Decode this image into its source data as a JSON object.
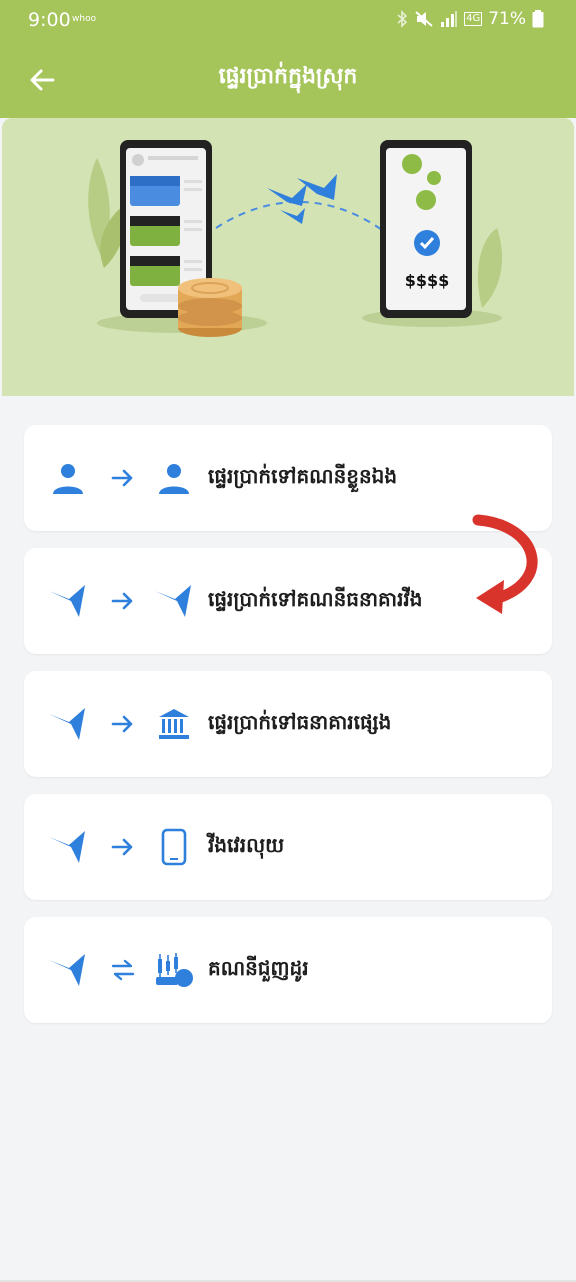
{
  "status_bar": {
    "time": "9:00",
    "carrier": "whoo",
    "battery": "71%",
    "network": "4G"
  },
  "header": {
    "title": "ផ្ទេរប្រាក់ក្នុងស្រុក",
    "back_icon": "arrow-left-icon"
  },
  "hero": {
    "amount_text": "$$$$"
  },
  "menu": {
    "items": [
      {
        "label": "ផ្ទេរប្រាក់ទៅគណនីខ្លួនឯង",
        "left_icon": "person-icon",
        "arrow_icon": "arrow-right-icon",
        "right_icon": "person-icon"
      },
      {
        "label": "ផ្ទេរប្រាក់ទៅគណនីធនាគារវីង",
        "left_icon": "swallow-icon",
        "arrow_icon": "arrow-right-icon",
        "right_icon": "swallow-icon"
      },
      {
        "label": "ផ្ទេរប្រាក់ទៅធនាគារផ្សេង",
        "left_icon": "swallow-icon",
        "arrow_icon": "arrow-right-icon",
        "right_icon": "bank-icon"
      },
      {
        "label": "វីងវេរលុយ",
        "left_icon": "swallow-icon",
        "arrow_icon": "arrow-right-icon",
        "right_icon": "phone-icon"
      },
      {
        "label": "គណនីជួញដូរ",
        "left_icon": "swallow-icon",
        "arrow_icon": "exchange-arrows-icon",
        "right_icon": "trading-icon"
      }
    ]
  },
  "colors": {
    "header_bg": "#a5c45a",
    "hero_bg": "#d4e3b4",
    "accent_blue": "#2f7fdc",
    "annotation_red": "#d9342b",
    "page_bg": "#f3f4f6"
  }
}
